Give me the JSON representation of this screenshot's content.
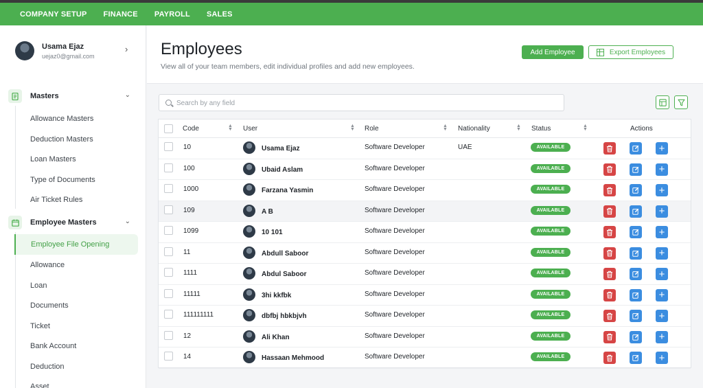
{
  "topnav": {
    "items": [
      "COMPANY SETUP",
      "FINANCE",
      "PAYROLL",
      "SALES"
    ]
  },
  "sidebar": {
    "profile": {
      "name": "Usama Ejaz",
      "email": "uejaz0@gmail.com"
    },
    "masters": {
      "label": "Masters",
      "items": [
        "Allowance Masters",
        "Deduction Masters",
        "Loan Masters",
        "Type of Documents",
        "Air Ticket Rules"
      ]
    },
    "employee_masters": {
      "label": "Employee Masters",
      "active_item": "Employee File Opening",
      "items": [
        "Allowance",
        "Loan",
        "Documents",
        "Ticket",
        "Bank Account",
        "Deduction",
        "Asset"
      ]
    }
  },
  "header": {
    "title": "Employees",
    "subtitle": "View all of your team members, edit individual profiles and add new employees.",
    "add_button": "Add Employee",
    "export_button": "Export Employees"
  },
  "search": {
    "placeholder": "Search by any field"
  },
  "table": {
    "columns": [
      "Code",
      "User",
      "Role",
      "Nationality",
      "Status",
      "Actions"
    ],
    "rows": [
      {
        "code": "10",
        "user": "Usama Ejaz",
        "role": "Software Developer",
        "nationality": "UAE",
        "status": "AVAILABLE"
      },
      {
        "code": "100",
        "user": "Ubaid Aslam",
        "role": "Software Developer",
        "nationality": "",
        "status": "AVAILABLE"
      },
      {
        "code": "1000",
        "user": "Farzana Yasmin",
        "role": "Software Developer",
        "nationality": "",
        "status": "AVAILABLE"
      },
      {
        "code": "109",
        "user": "A B",
        "role": "Software Developer",
        "nationality": "",
        "status": "AVAILABLE"
      },
      {
        "code": "1099",
        "user": "10 101",
        "role": "Software Developer",
        "nationality": "",
        "status": "AVAILABLE"
      },
      {
        "code": "11",
        "user": "Abdull Saboor",
        "role": "Software Developer",
        "nationality": "",
        "status": "AVAILABLE"
      },
      {
        "code": "1111",
        "user": "Abdul Saboor",
        "role": "Software Developer",
        "nationality": "",
        "status": "AVAILABLE"
      },
      {
        "code": "11111",
        "user": "3hi kkfbk",
        "role": "Software Developer",
        "nationality": "",
        "status": "AVAILABLE"
      },
      {
        "code": "111111111",
        "user": "dbfbj hbkbjvh",
        "role": "Software Developer",
        "nationality": "",
        "status": "AVAILABLE"
      },
      {
        "code": "12",
        "user": "Ali Khan",
        "role": "Software Developer",
        "nationality": "",
        "status": "AVAILABLE"
      },
      {
        "code": "14",
        "user": "Hassaan Mehmood",
        "role": "Software Developer",
        "nationality": "",
        "status": "AVAILABLE"
      }
    ]
  },
  "colors": {
    "brand": "#4caf50",
    "delete": "#d64545",
    "edit": "#3b8de0"
  },
  "icons": [
    "search-icon",
    "table-icon",
    "filter-icon",
    "trash-icon",
    "edit-icon",
    "plus-icon",
    "chevron-down-icon",
    "chevron-right-icon"
  ]
}
